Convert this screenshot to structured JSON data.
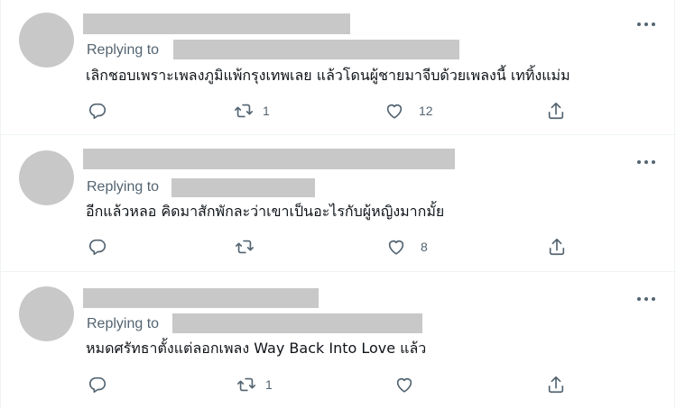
{
  "tweets": [
    {
      "replying_to": "Replying to",
      "text": "เลิกชอบเพราะเพลงภูมิแพ้กรุงเทพเลย แล้วโดนผู้ชายมาจีบด้วยเพลงนี้ เททิ้งแม่ม",
      "retweets": "1",
      "likes": "12"
    },
    {
      "replying_to": "Replying to",
      "text": "อีกแล้วหลอ คิดมาสักพักละว่าเขาเป็นอะไรกับผู้หญิงมากมั้ย",
      "retweets": "",
      "likes": "8"
    },
    {
      "replying_to": "Replying to",
      "text": "หมดศรัทธาตั้งแต่ลอกเพลง Way Back Into Love แล้ว",
      "retweets": "1",
      "likes": ""
    }
  ],
  "icons": {
    "reply": "reply-icon",
    "retweet": "retweet-icon",
    "like": "heart-icon",
    "share": "share-icon",
    "more": "more-options-icon"
  },
  "colors": {
    "icon": "#536471",
    "redacted": "#c8c8c8",
    "divider": "#eff3f4"
  }
}
